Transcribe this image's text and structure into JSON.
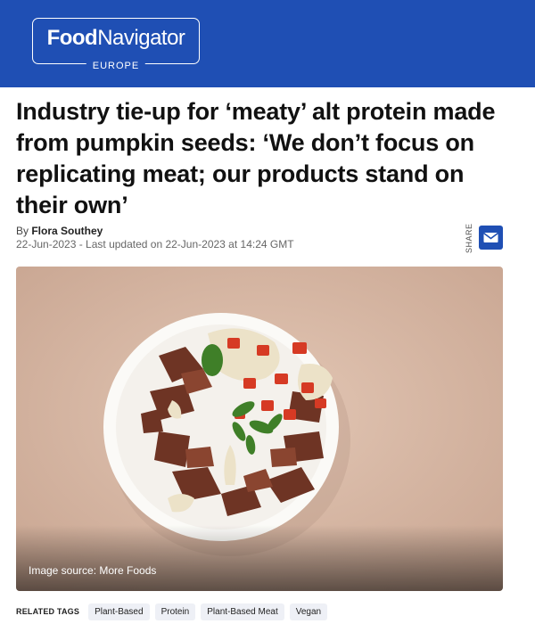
{
  "header": {
    "logo_food": "Food",
    "logo_navigator": "Navigator",
    "logo_region": "EUROPE"
  },
  "article": {
    "headline": "Industry tie-up for ‘meaty’ alt protein made from pumpkin seeds: ‘We don’t focus on replicating meat; our products stand on their own’",
    "byline_prefix": "By ",
    "author": "Flora Southey",
    "dateline": "22-Jun-2023 - Last updated on 22-Jun-2023 at 14:24 GMT",
    "share_label": "SHARE",
    "image_caption": "Image source: More Foods"
  },
  "related_tags": {
    "label": "RELATED TAGS",
    "items": [
      "Plant-Based",
      "Protein",
      "Plant-Based Meat",
      "Vegan"
    ]
  },
  "colors": {
    "brand": "#1f4fb4",
    "tag_bg": "#eef0f6"
  },
  "icons": {
    "share_button": "envelope-icon"
  }
}
